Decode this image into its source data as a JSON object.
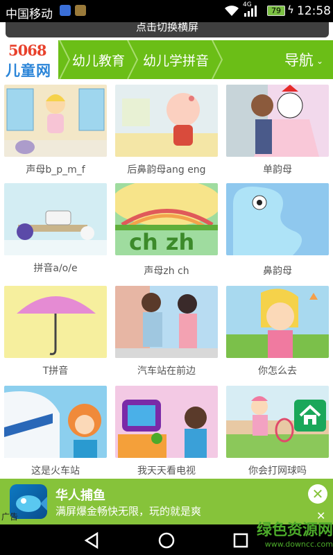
{
  "status_bar": {
    "carrier": "中国移动",
    "network": "4G",
    "battery": "79",
    "time": "12:58"
  },
  "switch_bar": {
    "label": "点击切换横屏"
  },
  "header": {
    "logo_number": "5068",
    "logo_text": "儿童网",
    "breadcrumbs": [
      "幼儿教育",
      "幼儿学拼音"
    ],
    "menu_label": "导航"
  },
  "tiles": [
    {
      "caption": "声母b_p_m_f",
      "thumb_bg": "#f3e7c7"
    },
    {
      "caption": "后鼻韵母ang eng",
      "thumb_bg": "#e4eef0"
    },
    {
      "caption": "单韵母",
      "thumb_bg": "#f2d9ec"
    },
    {
      "caption": "拼音a/o/e",
      "thumb_bg": "#d3edf3"
    },
    {
      "caption": "声母zh ch",
      "thumb_bg": "#9fdc9f"
    },
    {
      "caption": "鼻韵母",
      "thumb_bg": "#8fc8ee"
    },
    {
      "caption": "T拼音",
      "thumb_bg": "#f6ef9e"
    },
    {
      "caption": "汽车站在前边",
      "thumb_bg": "#b8dcf2"
    },
    {
      "caption": "你怎么去",
      "thumb_bg": "#a8d9ef"
    },
    {
      "caption": "这是火车站",
      "thumb_bg": "#8ccfee"
    },
    {
      "caption": "我天天看电视",
      "thumb_bg": "#f3c9e4"
    },
    {
      "caption": "你会打网球吗",
      "thumb_bg": "#d7edf4"
    }
  ],
  "ad": {
    "title": "华人捕鱼",
    "description": "满屏爆金畅快无限，玩的就是爽",
    "tag": "广告"
  },
  "watermark": {
    "text": "绿色资源网",
    "url": "www.downcc.com"
  },
  "colors": {
    "brand_green": "#6bbe17",
    "ad_green": "#86c33a",
    "home_green": "#1aa75a"
  }
}
